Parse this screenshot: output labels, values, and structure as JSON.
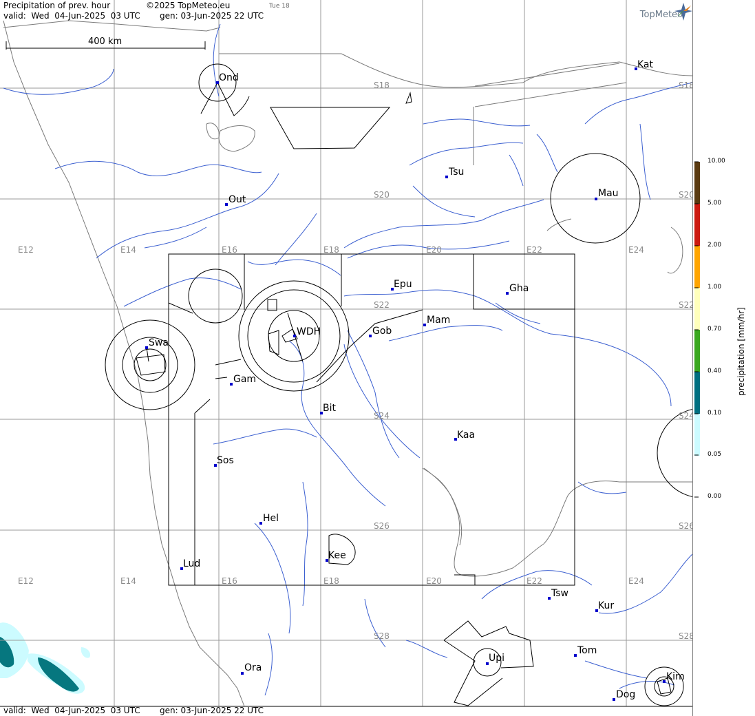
{
  "header": {
    "title": "Precipitation of prev. hour",
    "copyright": "©2025 TopMeteo.eu",
    "day_label": "Tue 18",
    "valid": "valid:  Wed  04-Jun-2025  03 UTC",
    "gen": "gen: 03-Jun-2025 22 UTC",
    "brand": "TopMeteo",
    "scale_label": "400 km"
  },
  "colors": {
    "grid": "#9a9a9a",
    "coast": "#777777",
    "river": "#3b5fd0",
    "airspace": "#000000",
    "station": "#0000cc",
    "precip_light": "#ccfbff",
    "precip_dark": "#06777f"
  },
  "grid_labels": {
    "lon": [
      "E12",
      "E14",
      "E16",
      "E18",
      "E20",
      "E22",
      "E24"
    ],
    "lat": [
      "S18",
      "S20",
      "S22",
      "S24",
      "S26",
      "S28"
    ]
  },
  "stations": [
    {
      "code": "Ond"
    },
    {
      "code": "Kat"
    },
    {
      "code": "Tsu"
    },
    {
      "code": "Mau"
    },
    {
      "code": "Out"
    },
    {
      "code": "Epu"
    },
    {
      "code": "Gha"
    },
    {
      "code": "Mam"
    },
    {
      "code": "Gob"
    },
    {
      "code": "WDH"
    },
    {
      "code": "Swa"
    },
    {
      "code": "Gam"
    },
    {
      "code": "Bit"
    },
    {
      "code": "Kaa"
    },
    {
      "code": "Sos"
    },
    {
      "code": "Hel"
    },
    {
      "code": "Kee"
    },
    {
      "code": "Lud"
    },
    {
      "code": "Tsw"
    },
    {
      "code": "Kur"
    },
    {
      "code": "Tom"
    },
    {
      "code": "Upi"
    },
    {
      "code": "Ora"
    },
    {
      "code": "Kim"
    },
    {
      "code": "Dog"
    }
  ],
  "legend": {
    "title": "precipitation [mm/hr]",
    "ticks": [
      "10.00",
      "5.00",
      "2.00",
      "1.00",
      "0.70",
      "0.40",
      "0.10",
      "0.05",
      "0.00"
    ],
    "colors": [
      "#5a3a10",
      "#cc1a10",
      "#ffa500",
      "#ffffbb",
      "#3aa820",
      "#006f80",
      "#ccfbff"
    ]
  }
}
